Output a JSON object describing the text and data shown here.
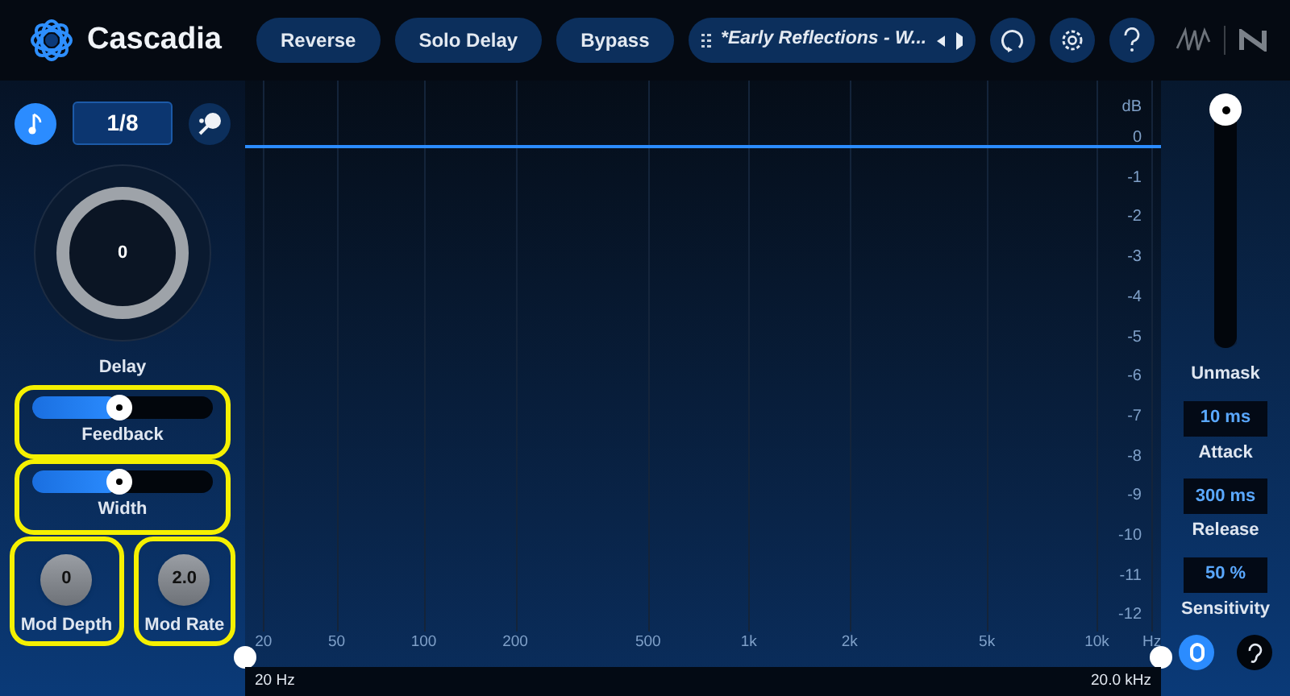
{
  "app": {
    "title": "Cascadia"
  },
  "header_buttons": [
    {
      "label": "Reverse",
      "on": false
    },
    {
      "label": "Solo Delay",
      "on": false
    },
    {
      "label": "Bypass",
      "on": false
    }
  ],
  "preset": {
    "name": "*Early Reflections - W..."
  },
  "left_panel": {
    "sync_on": true,
    "division": "1/8",
    "delay": {
      "value": "0",
      "label": "Delay"
    },
    "sliders": [
      {
        "label": "Feedback",
        "level": 0.48,
        "highlighted": true
      },
      {
        "label": "Width",
        "level": 0.48,
        "highlighted": true
      }
    ],
    "knobs": [
      {
        "value": "0",
        "label": "Mod Depth",
        "highlighted": true
      },
      {
        "value": "2.0",
        "label": "Mod Rate",
        "highlighted": true
      }
    ]
  },
  "graph": {
    "db_unit": "dB",
    "db_ticks": [
      "0",
      "-1",
      "-2",
      "-3",
      "-4",
      "-5",
      "-6",
      "-7",
      "-8",
      "-9",
      "-10",
      "-11",
      "-12"
    ],
    "freq_ticks": [
      "20",
      "50",
      "100",
      "200",
      "500",
      "1k",
      "2k",
      "5k",
      "10k",
      "Hz"
    ],
    "low_freq": "20 Hz",
    "high_freq": "20.0 kHz"
  },
  "right_panel": {
    "unmask": {
      "label": "Unmask",
      "level": 1
    },
    "fields": [
      {
        "value": "10 ms",
        "label": "Attack"
      },
      {
        "value": "300 ms",
        "label": "Release"
      },
      {
        "value": "50 %",
        "label": "Sensitivity"
      }
    ],
    "power_on": true,
    "listen_on": false
  }
}
